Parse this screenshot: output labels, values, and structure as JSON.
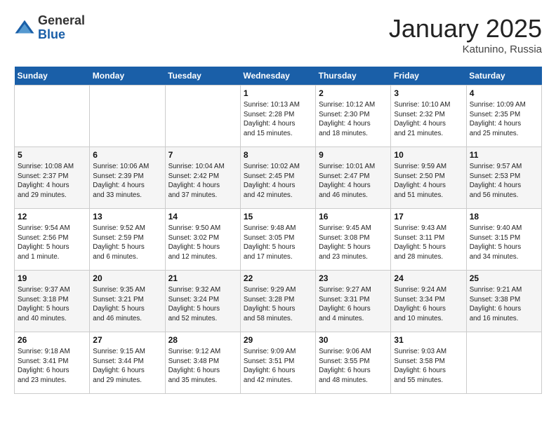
{
  "header": {
    "logo_general": "General",
    "logo_blue": "Blue",
    "month_title": "January 2025",
    "location": "Katunino, Russia"
  },
  "weekdays": [
    "Sunday",
    "Monday",
    "Tuesday",
    "Wednesday",
    "Thursday",
    "Friday",
    "Saturday"
  ],
  "weeks": [
    [
      {
        "day": "",
        "info": ""
      },
      {
        "day": "",
        "info": ""
      },
      {
        "day": "",
        "info": ""
      },
      {
        "day": "1",
        "info": "Sunrise: 10:13 AM\nSunset: 2:28 PM\nDaylight: 4 hours\nand 15 minutes."
      },
      {
        "day": "2",
        "info": "Sunrise: 10:12 AM\nSunset: 2:30 PM\nDaylight: 4 hours\nand 18 minutes."
      },
      {
        "day": "3",
        "info": "Sunrise: 10:10 AM\nSunset: 2:32 PM\nDaylight: 4 hours\nand 21 minutes."
      },
      {
        "day": "4",
        "info": "Sunrise: 10:09 AM\nSunset: 2:35 PM\nDaylight: 4 hours\nand 25 minutes."
      }
    ],
    [
      {
        "day": "5",
        "info": "Sunrise: 10:08 AM\nSunset: 2:37 PM\nDaylight: 4 hours\nand 29 minutes."
      },
      {
        "day": "6",
        "info": "Sunrise: 10:06 AM\nSunset: 2:39 PM\nDaylight: 4 hours\nand 33 minutes."
      },
      {
        "day": "7",
        "info": "Sunrise: 10:04 AM\nSunset: 2:42 PM\nDaylight: 4 hours\nand 37 minutes."
      },
      {
        "day": "8",
        "info": "Sunrise: 10:02 AM\nSunset: 2:45 PM\nDaylight: 4 hours\nand 42 minutes."
      },
      {
        "day": "9",
        "info": "Sunrise: 10:01 AM\nSunset: 2:47 PM\nDaylight: 4 hours\nand 46 minutes."
      },
      {
        "day": "10",
        "info": "Sunrise: 9:59 AM\nSunset: 2:50 PM\nDaylight: 4 hours\nand 51 minutes."
      },
      {
        "day": "11",
        "info": "Sunrise: 9:57 AM\nSunset: 2:53 PM\nDaylight: 4 hours\nand 56 minutes."
      }
    ],
    [
      {
        "day": "12",
        "info": "Sunrise: 9:54 AM\nSunset: 2:56 PM\nDaylight: 5 hours\nand 1 minute."
      },
      {
        "day": "13",
        "info": "Sunrise: 9:52 AM\nSunset: 2:59 PM\nDaylight: 5 hours\nand 6 minutes."
      },
      {
        "day": "14",
        "info": "Sunrise: 9:50 AM\nSunset: 3:02 PM\nDaylight: 5 hours\nand 12 minutes."
      },
      {
        "day": "15",
        "info": "Sunrise: 9:48 AM\nSunset: 3:05 PM\nDaylight: 5 hours\nand 17 minutes."
      },
      {
        "day": "16",
        "info": "Sunrise: 9:45 AM\nSunset: 3:08 PM\nDaylight: 5 hours\nand 23 minutes."
      },
      {
        "day": "17",
        "info": "Sunrise: 9:43 AM\nSunset: 3:11 PM\nDaylight: 5 hours\nand 28 minutes."
      },
      {
        "day": "18",
        "info": "Sunrise: 9:40 AM\nSunset: 3:15 PM\nDaylight: 5 hours\nand 34 minutes."
      }
    ],
    [
      {
        "day": "19",
        "info": "Sunrise: 9:37 AM\nSunset: 3:18 PM\nDaylight: 5 hours\nand 40 minutes."
      },
      {
        "day": "20",
        "info": "Sunrise: 9:35 AM\nSunset: 3:21 PM\nDaylight: 5 hours\nand 46 minutes."
      },
      {
        "day": "21",
        "info": "Sunrise: 9:32 AM\nSunset: 3:24 PM\nDaylight: 5 hours\nand 52 minutes."
      },
      {
        "day": "22",
        "info": "Sunrise: 9:29 AM\nSunset: 3:28 PM\nDaylight: 5 hours\nand 58 minutes."
      },
      {
        "day": "23",
        "info": "Sunrise: 9:27 AM\nSunset: 3:31 PM\nDaylight: 6 hours\nand 4 minutes."
      },
      {
        "day": "24",
        "info": "Sunrise: 9:24 AM\nSunset: 3:34 PM\nDaylight: 6 hours\nand 10 minutes."
      },
      {
        "day": "25",
        "info": "Sunrise: 9:21 AM\nSunset: 3:38 PM\nDaylight: 6 hours\nand 16 minutes."
      }
    ],
    [
      {
        "day": "26",
        "info": "Sunrise: 9:18 AM\nSunset: 3:41 PM\nDaylight: 6 hours\nand 23 minutes."
      },
      {
        "day": "27",
        "info": "Sunrise: 9:15 AM\nSunset: 3:44 PM\nDaylight: 6 hours\nand 29 minutes."
      },
      {
        "day": "28",
        "info": "Sunrise: 9:12 AM\nSunset: 3:48 PM\nDaylight: 6 hours\nand 35 minutes."
      },
      {
        "day": "29",
        "info": "Sunrise: 9:09 AM\nSunset: 3:51 PM\nDaylight: 6 hours\nand 42 minutes."
      },
      {
        "day": "30",
        "info": "Sunrise: 9:06 AM\nSunset: 3:55 PM\nDaylight: 6 hours\nand 48 minutes."
      },
      {
        "day": "31",
        "info": "Sunrise: 9:03 AM\nSunset: 3:58 PM\nDaylight: 6 hours\nand 55 minutes."
      },
      {
        "day": "",
        "info": ""
      }
    ]
  ]
}
